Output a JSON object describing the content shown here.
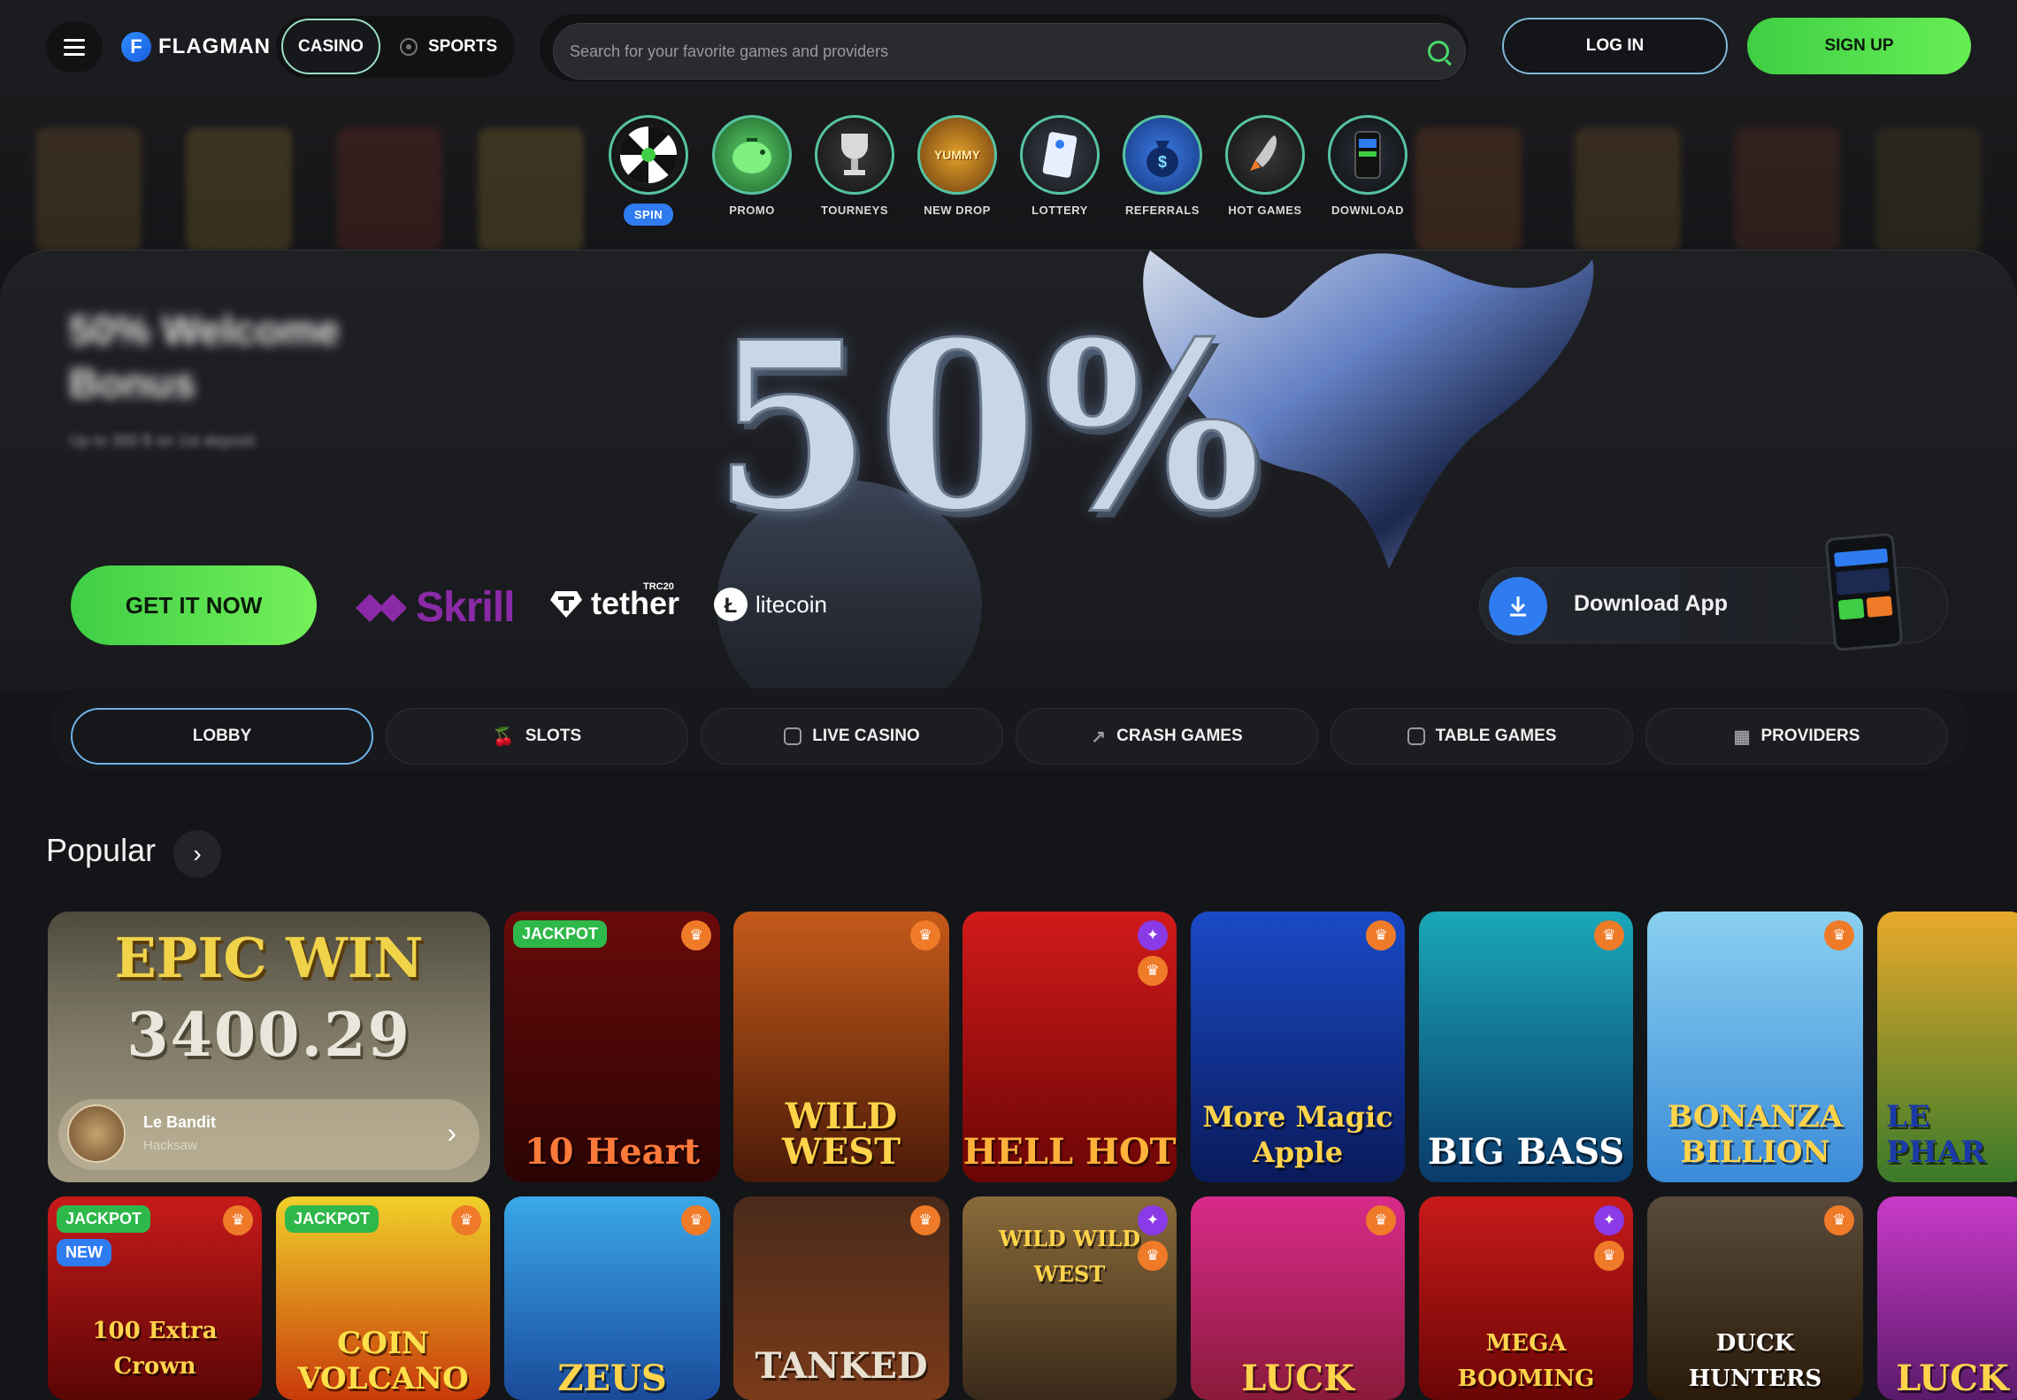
{
  "header": {
    "logo_text": "FLAGMAN",
    "logo_mark": "F",
    "tab_casino": "CASINO",
    "tab_sports": "SPORTS",
    "search_placeholder": "Search for your favorite games and providers",
    "login": "LOG IN",
    "signup": "SIGN UP"
  },
  "quick_nav": [
    {
      "label": "SPIN",
      "icon": "spin-wheel-icon",
      "active": true
    },
    {
      "label": "PROMO",
      "icon": "piggy-bank-icon"
    },
    {
      "label": "TOURNEYS",
      "icon": "trophy-icon"
    },
    {
      "label": "NEW DROP",
      "icon": "yummy-dumplings-icon"
    },
    {
      "label": "LOTTERY",
      "icon": "lottery-ticket-icon"
    },
    {
      "label": "REFERRALS",
      "icon": "money-bag-icon"
    },
    {
      "label": "HOT GAMES",
      "icon": "rocket-icon"
    },
    {
      "label": "DOWNLOAD",
      "icon": "phone-icon"
    }
  ],
  "hero": {
    "title": "50% Welcome Bonus",
    "subtitle": "Up to 300 $ on 1st deposit",
    "big_text": "50%",
    "cta": "GET IT NOW",
    "payments": {
      "skrill": "Skrill",
      "tether": "tether",
      "tether_tag": "TRC20",
      "litecoin": "litecoin"
    },
    "download_label": "Download App"
  },
  "categories": [
    "LOBBY",
    "SLOTS",
    "LIVE CASINO",
    "CRASH GAMES",
    "TABLE GAMES",
    "PROVIDERS"
  ],
  "popular": {
    "title": "Popular",
    "epic_win": {
      "title": "EPIC WIN",
      "value": "3400.29",
      "game": "Le Bandit",
      "provider": "Hacksaw"
    },
    "row1": [
      {
        "name": "10 Heart",
        "badge": "JACKPOT",
        "icon": "trophy-icon"
      },
      {
        "name": "WILD WEST",
        "icon": "trophy-icon"
      },
      {
        "name": "HELL HOT",
        "icon": "gift-icon",
        "icon2": "trophy-icon"
      },
      {
        "name": "More Magic Apple",
        "icon": "trophy-icon"
      },
      {
        "name": "BIG BASS",
        "icon": "trophy-icon"
      },
      {
        "name": "BONANZA BILLION",
        "icon": "trophy-icon"
      },
      {
        "name": "LE PHAR",
        "icon": ""
      }
    ],
    "row2": [
      {
        "name": "100 Extra Crown",
        "badge": "JACKPOT",
        "badge2": "NEW",
        "icon": "trophy-icon"
      },
      {
        "name": "COIN VOLCANO",
        "badge": "JACKPOT",
        "icon": "trophy-icon"
      },
      {
        "name": "ZEUS",
        "icon": "trophy-icon"
      },
      {
        "name": "TANKED",
        "icon": "trophy-icon"
      },
      {
        "name": "WILD WILD WEST",
        "icon": "gift-icon",
        "icon2": "trophy-icon"
      },
      {
        "name": "LUCK",
        "icon": "trophy-icon"
      },
      {
        "name": "MEGA BOOMING",
        "icon": "gift-icon",
        "icon2": "trophy-icon"
      },
      {
        "name": "DUCK HUNTERS",
        "icon": "trophy-icon"
      },
      {
        "name": "LUCK",
        "icon": ""
      }
    ]
  },
  "colors": {
    "accent_green": "#4ad96a",
    "accent_blue": "#2f7cf0",
    "trophy_orange": "#ef7a28",
    "gift_purple": "#8a3ae6"
  }
}
